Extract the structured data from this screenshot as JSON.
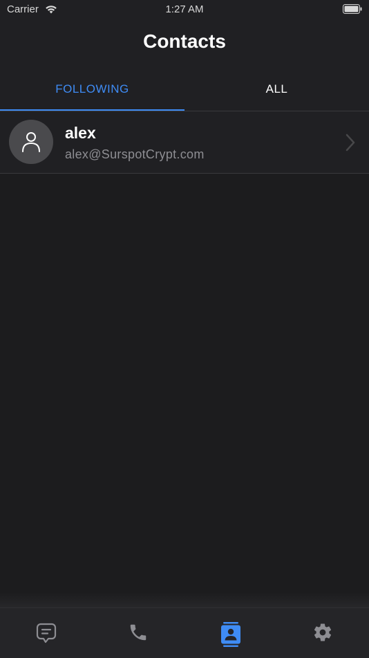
{
  "status_bar": {
    "carrier": "Carrier",
    "time": "1:27 AM"
  },
  "header": {
    "title": "Contacts"
  },
  "tabs": [
    {
      "label": "FOLLOWING",
      "active": true
    },
    {
      "label": "ALL",
      "active": false
    }
  ],
  "contacts": [
    {
      "name": "alex",
      "email": "alex@SurspotCrypt.com"
    }
  ],
  "bottom_tabs": [
    {
      "icon": "message-icon",
      "active": false
    },
    {
      "icon": "phone-icon",
      "active": false
    },
    {
      "icon": "contacts-icon",
      "active": true
    },
    {
      "icon": "gear-icon",
      "active": false
    }
  ],
  "colors": {
    "accent": "#3f8cf5",
    "background": "#1c1c1e",
    "header_background": "#202023",
    "secondary_text": "#8e8e93",
    "inactive_icon": "#8e8e93"
  }
}
